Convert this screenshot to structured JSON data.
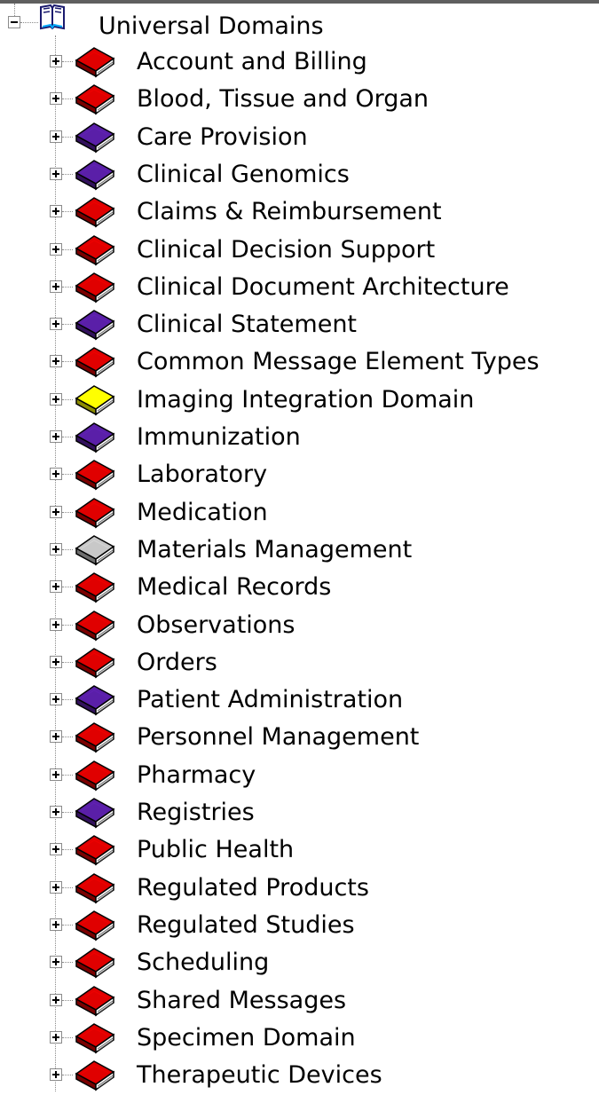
{
  "tree": {
    "root": {
      "label": "Universal Domains",
      "icon": "open-book-icon",
      "expanded": true
    },
    "items": [
      {
        "label": "Account and Billing",
        "color": "#e00000"
      },
      {
        "label": "Blood, Tissue and Organ",
        "color": "#e00000"
      },
      {
        "label": "Care Provision",
        "color": "#5a1fa8"
      },
      {
        "label": "Clinical Genomics",
        "color": "#5a1fa8"
      },
      {
        "label": "Claims & Reimbursement",
        "color": "#e00000"
      },
      {
        "label": "Clinical Decision Support",
        "color": "#e00000"
      },
      {
        "label": "Clinical Document Architecture",
        "color": "#e00000"
      },
      {
        "label": "Clinical Statement",
        "color": "#5a1fa8"
      },
      {
        "label": "Common Message Element Types",
        "color": "#e00000"
      },
      {
        "label": "Imaging Integration Domain",
        "color": "#ffff00"
      },
      {
        "label": "Immunization",
        "color": "#5a1fa8"
      },
      {
        "label": "Laboratory",
        "color": "#e00000"
      },
      {
        "label": "Medication",
        "color": "#e00000"
      },
      {
        "label": "Materials Management",
        "color": "#c8c8c8"
      },
      {
        "label": "Medical Records",
        "color": "#e00000"
      },
      {
        "label": "Observations",
        "color": "#e00000"
      },
      {
        "label": "Orders",
        "color": "#e00000"
      },
      {
        "label": "Patient Administration",
        "color": "#5a1fa8"
      },
      {
        "label": "Personnel Management",
        "color": "#e00000"
      },
      {
        "label": "Pharmacy",
        "color": "#e00000"
      },
      {
        "label": "Registries",
        "color": "#5a1fa8"
      },
      {
        "label": "Public Health",
        "color": "#e00000"
      },
      {
        "label": "Regulated Products",
        "color": "#e00000"
      },
      {
        "label": "Regulated Studies",
        "color": "#e00000"
      },
      {
        "label": "Scheduling",
        "color": "#e00000"
      },
      {
        "label": "Shared Messages",
        "color": "#e00000"
      },
      {
        "label": "Specimen Domain",
        "color": "#e00000"
      },
      {
        "label": "Therapeutic Devices",
        "color": "#e00000"
      }
    ]
  }
}
